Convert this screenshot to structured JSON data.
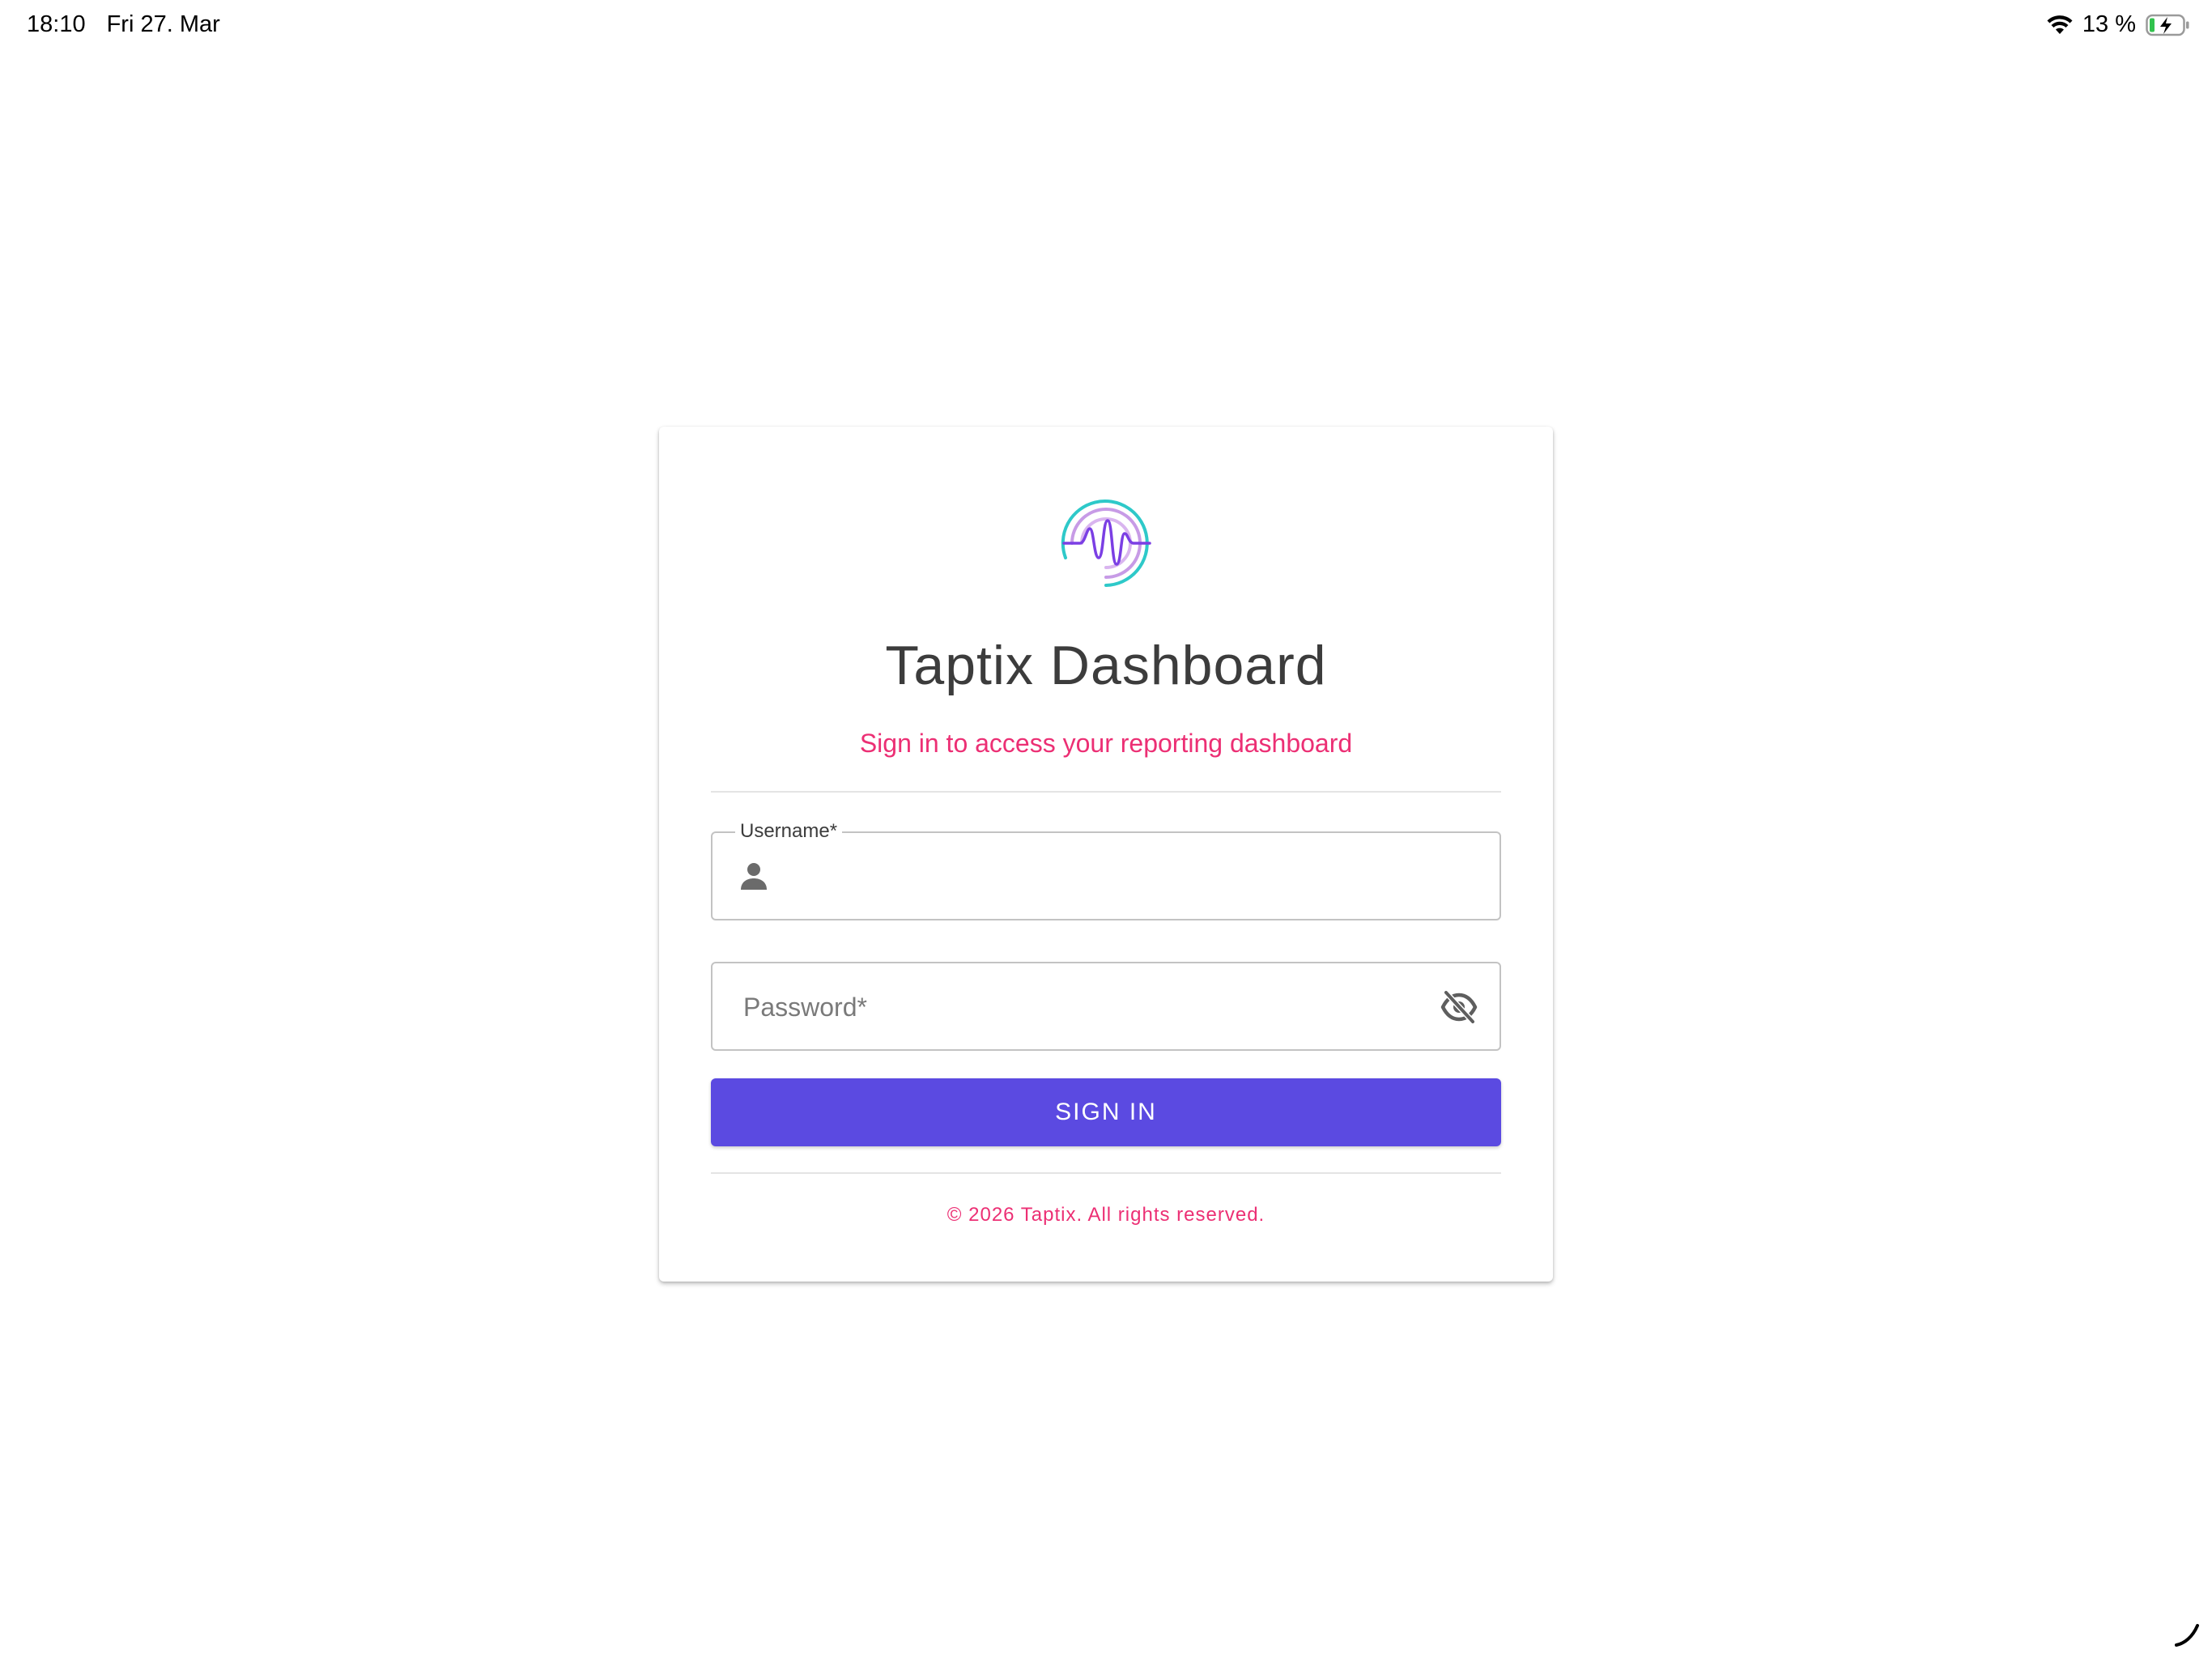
{
  "status_bar": {
    "time": "18:10",
    "date": "Fri 27. Mar",
    "battery_percent": "13 %",
    "icons": [
      "wifi-icon",
      "battery-charging-icon"
    ]
  },
  "login": {
    "logo_icon": "waveform-logo-icon",
    "title": "Taptix Dashboard",
    "subtitle": "Sign in to access your reporting dashboard",
    "username": {
      "label": "Username*",
      "value": "",
      "icon": "person-icon"
    },
    "password": {
      "placeholder": "Password*",
      "value": "",
      "toggle_icon": "eye-off-icon"
    },
    "sign_in_label": "SIGN IN",
    "footer": "© 2026 Taptix. All rights reserved."
  },
  "colors": {
    "accent_button": "#5b4ae1",
    "subtitle_pink": "#ec2f74",
    "title_text": "#3c3c3c",
    "logo_teal": "#2ec9c9",
    "logo_purple": "#7b3fe4",
    "logo_lilac": "#c79be6"
  }
}
